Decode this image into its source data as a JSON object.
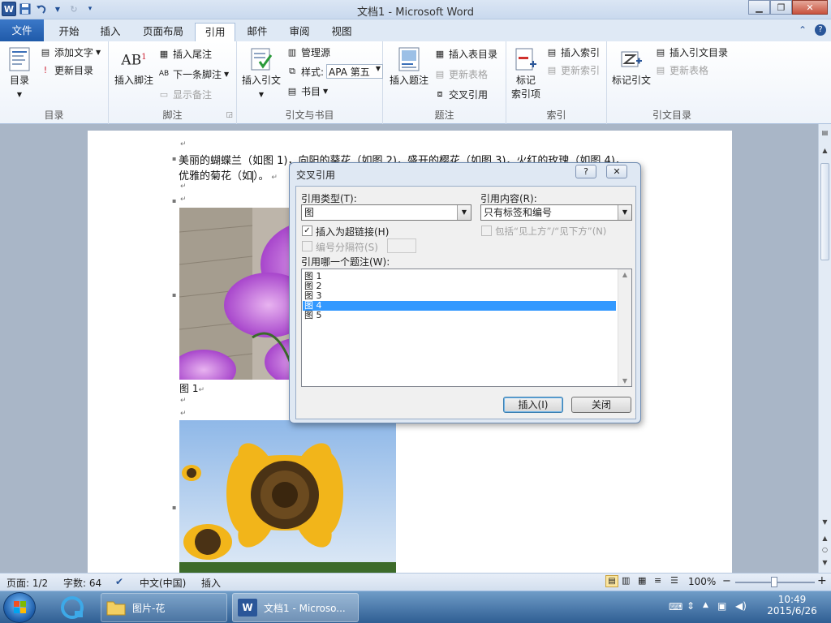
{
  "window": {
    "title": "文档1 - Microsoft Word",
    "qat_icons": [
      "word-logo-icon",
      "save-icon",
      "undo-icon",
      "redo-icon",
      "customize-qat-icon"
    ],
    "controls": [
      "minimize",
      "maximize",
      "close"
    ]
  },
  "tabs": [
    {
      "label": "文件"
    },
    {
      "label": "开始"
    },
    {
      "label": "插入"
    },
    {
      "label": "页面布局"
    },
    {
      "label": "引用"
    },
    {
      "label": "邮件"
    },
    {
      "label": "审阅"
    },
    {
      "label": "视图"
    }
  ],
  "active_tab": "引用",
  "ribbon": {
    "toc": {
      "big": "目录",
      "add_text": "添加文字",
      "update": "更新目录",
      "group": "目录"
    },
    "footnotes": {
      "big": "插入脚注",
      "endnote": "插入尾注",
      "next": "下一条脚注",
      "show": "显示备注",
      "group": "脚注"
    },
    "citations": {
      "big": "插入引文",
      "manage": "管理源",
      "style_label": "样式:",
      "style_value": "APA 第五",
      "bib": "书目",
      "group": "引文与书目"
    },
    "captions": {
      "big": "插入题注",
      "table_figures": "插入表目录",
      "update_table": "更新表格",
      "cross_ref": "交叉引用",
      "group": "题注"
    },
    "index": {
      "big_line1": "标记",
      "big_line2": "索引项",
      "insert": "插入索引",
      "update": "更新索引",
      "group": "索引"
    },
    "toa": {
      "big": "标记引文",
      "insert": "插入引文目录",
      "update": "更新表格",
      "group": "引文目录"
    }
  },
  "document": {
    "line1": "美丽的蝴蝶兰（如图 1)，向阳的葵花（如图 2)，盛开的樱花（如图 3)，火红的玫瑰（如图 4)，",
    "line2_before_cursor": "优雅的菊花（如",
    "line2_after_cursor": "）。",
    "caption1": "图 1"
  },
  "dialog": {
    "title": "交叉引用",
    "help": "?",
    "type_label": "引用类型(T):",
    "type_value": "图",
    "content_label": "引用内容(R):",
    "content_value": "只有标签和编号",
    "insert_hyperlink": "插入为超链接(H)",
    "insert_hyperlink_checked": true,
    "include_above_below": "包括“见上方”/“见下方”(N)",
    "separator_label": "编号分隔符(S)",
    "which_caption_label": "引用哪一个题注(W):",
    "captions": [
      "图 1",
      "图 2",
      "图 3",
      "图 4",
      "图 5"
    ],
    "selected_index": 3,
    "insert_button": "插入(I)",
    "close_button": "关闭"
  },
  "statusbar": {
    "page": "页面: 1/2",
    "words": "字数: 64",
    "language": "中文(中国)",
    "mode": "插入",
    "zoom": "100%",
    "zoom_minus": "−",
    "zoom_plus": "+"
  },
  "taskbar": {
    "items": [
      {
        "label": "图片-花",
        "icon": "folder-icon"
      },
      {
        "label": "文档1 - Microso...",
        "icon": "word-icon"
      }
    ],
    "time": "10:49",
    "date": "2015/6/26"
  },
  "colors": {
    "accent": "#2a5699",
    "selection": "#3399ff"
  }
}
